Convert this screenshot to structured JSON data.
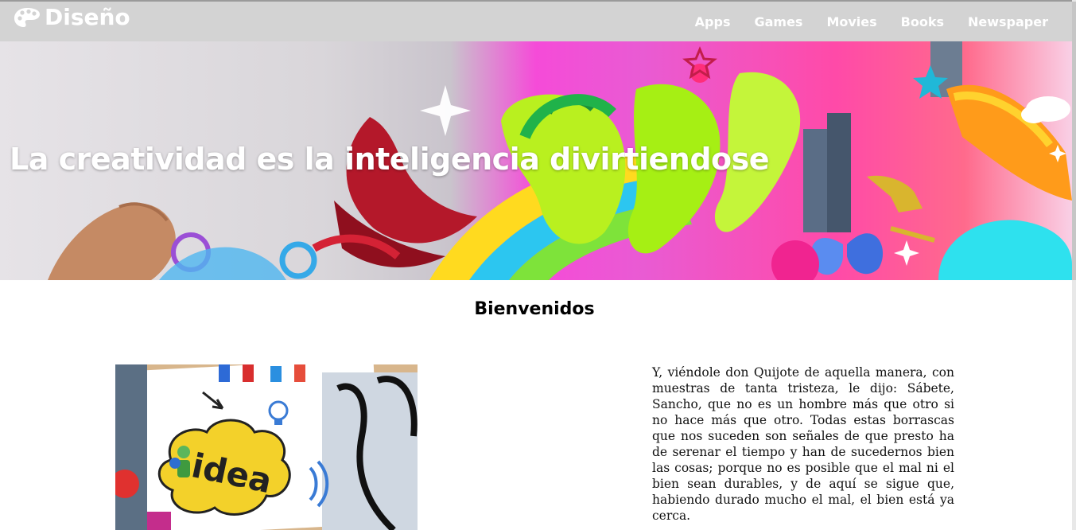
{
  "navbar": {
    "brand": "Diseño",
    "brand_icon": "palette-icon",
    "links": [
      "Apps",
      "Games",
      "Movies",
      "Books",
      "Newspaper"
    ]
  },
  "hero": {
    "title": "La creatividad es la inteligencia divirtiendose"
  },
  "main": {
    "heading": "Bienvenidos",
    "paragraph": "Y, viéndole don Quijote de aquella manera, con muestras de tanta tristeza, le dijo: Sábete, Sancho, que no es un hombre más que otro si no hace más que otro. Todas estas borrascas que nos suceden son señales de que presto ha de serenar el tiempo y han de sucedernos bien las cosas; porque no es posible que el mal ni el bien sean durables, y de aquí se sigue que, habiendo durado mucho el mal, el bien está ya cerca.",
    "image_caption_word": "idea"
  },
  "colors": {
    "navbar_bg": "#d3d3d3",
    "nav_text": "#ffffff"
  }
}
